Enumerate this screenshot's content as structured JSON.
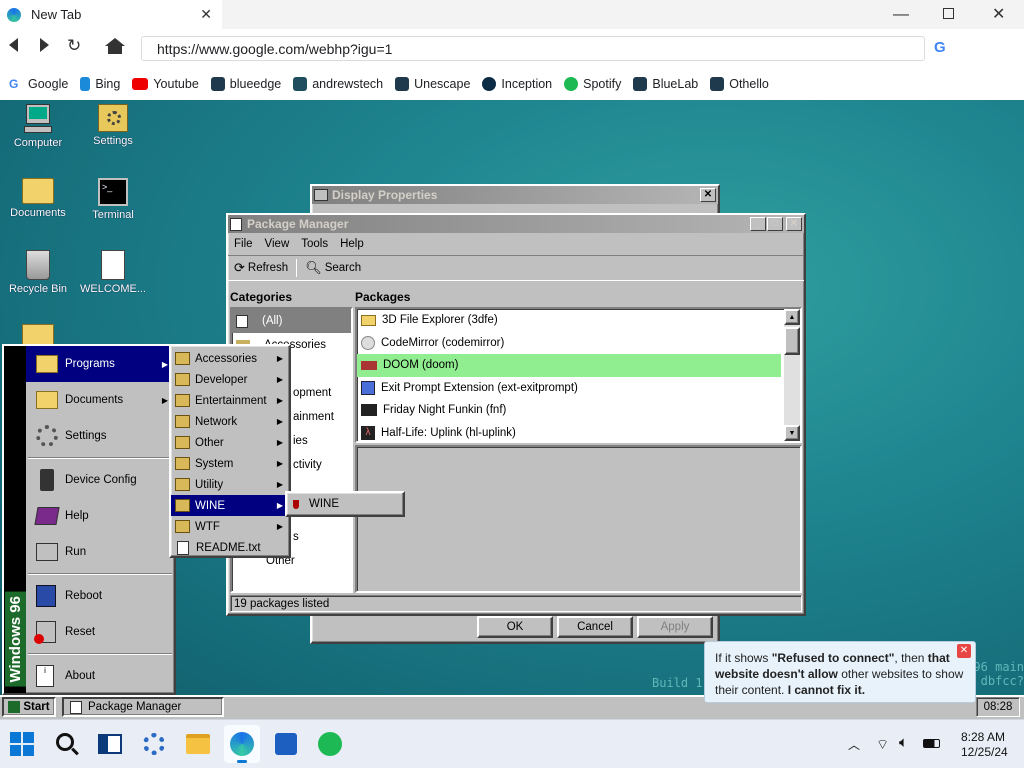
{
  "browser": {
    "tab_title": "New Tab",
    "url": "https://www.google.com/webhp?igu=1",
    "bookmarks": [
      "Google",
      "Bing",
      "Youtube",
      "blueedge",
      "andrewstech",
      "Unescape",
      "Inception",
      "Spotify",
      "BlueLab",
      "Othello"
    ]
  },
  "desktop": {
    "icons": [
      "Computer",
      "Settings",
      "Documents",
      "Terminal",
      "Recycle Bin",
      "WELCOME..."
    ],
    "watermark_line1": "96 main",
    "watermark_line2": "Build 1",
    "watermark_line3": "dbfcc?"
  },
  "display_properties": {
    "title": "Display Properties",
    "ok": "OK",
    "cancel": "Cancel",
    "apply": "Apply"
  },
  "package_manager": {
    "title": "Package Manager",
    "menu": [
      "File",
      "View",
      "Tools",
      "Help"
    ],
    "toolbar": {
      "refresh": "Refresh",
      "search": "Search"
    },
    "categories_header": "Categories",
    "packages_header": "Packages",
    "categories": [
      "(All)",
      "Accessories",
      "",
      "opment",
      "ainment",
      "ies",
      "ctivity",
      "",
      "",
      "s",
      "Other"
    ],
    "packages": [
      "3D File Explorer (3dfe)",
      "CodeMirror (codemirror)",
      "DOOM (doom)",
      "Exit Prompt Extension (ext-exitprompt)",
      "Friday Night Funkin (fnf)",
      "Half-Life: Uplink (hl-uplink)"
    ],
    "status": "19 packages listed"
  },
  "start_menu": {
    "brand": "Windows 96",
    "items": [
      "Programs",
      "Documents",
      "Settings",
      "Device Config",
      "Help",
      "Run",
      "Reboot",
      "Reset",
      "About"
    ]
  },
  "programs_menu": {
    "items": [
      "Accessories",
      "Developer",
      "Entertainment",
      "Network",
      "Other",
      "System",
      "Utility",
      "WINE",
      "WTF",
      "README.txt"
    ]
  },
  "wine_menu": {
    "items": [
      "WINE"
    ]
  },
  "w96_taskbar": {
    "start": "Start",
    "task": "Package Manager",
    "clock": "08:28"
  },
  "notice": {
    "p1": "If it shows ",
    "b1": "\"Refused to connect\"",
    "p2": ", then ",
    "b2": "that website doesn't allow",
    "p3": " other websites to show their content. ",
    "b3": "I cannot fix it."
  },
  "win_taskbar": {
    "time": "8:28 AM",
    "date": "12/25/24"
  }
}
